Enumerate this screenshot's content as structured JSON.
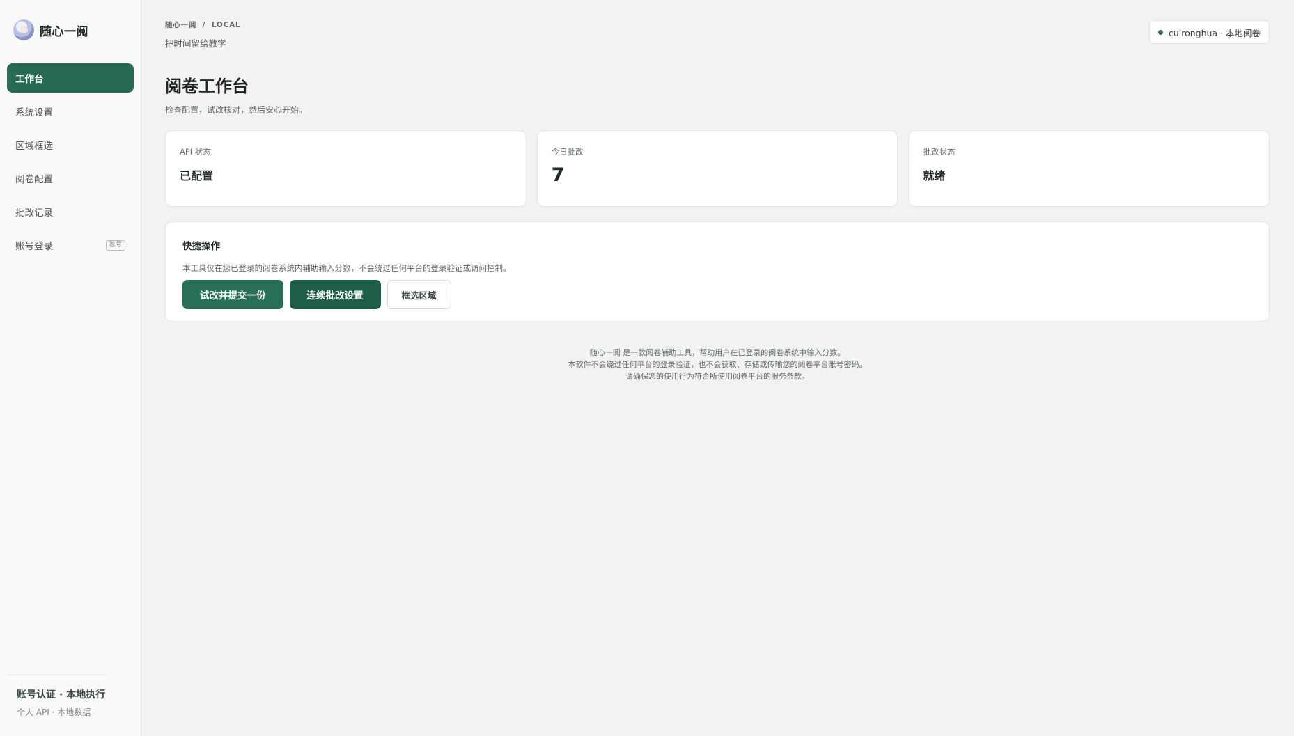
{
  "app": {
    "name": "随心一阅"
  },
  "sidebar": {
    "items": [
      {
        "label": "工作台",
        "active": true
      },
      {
        "label": "系统设置"
      },
      {
        "label": "区域框选"
      },
      {
        "label": "阅卷配置"
      },
      {
        "label": "批改记录"
      },
      {
        "label": "账号登录",
        "badge": "账号"
      }
    ],
    "footer": {
      "title": "账号认证 · 本地执行",
      "subtitle": "个人 API · 本地数据"
    }
  },
  "header": {
    "breadcrumb": [
      "随心一阅",
      "LOCAL"
    ],
    "breadcrumb_sep": "/",
    "slogan": "把时间留给教学",
    "user_chip": "cuironghua · 本地阅卷"
  },
  "page": {
    "title": "阅卷工作台",
    "subtitle": "检查配置，试改核对，然后安心开始。"
  },
  "stats": [
    {
      "label": "API 状态",
      "value": "已配置"
    },
    {
      "label": "今日批改",
      "value": "7"
    },
    {
      "label": "批改状态",
      "value": "就绪"
    }
  ],
  "quick_actions": {
    "title": "快捷操作",
    "description": "本工具仅在您已登录的阅卷系统内辅助输入分数，不会绕过任何平台的登录验证或访问控制。",
    "buttons": [
      "试改并提交一份",
      "连续批改设置",
      "框选区域"
    ]
  },
  "disclaimer": [
    "随心一阅 是一款阅卷辅助工具，帮助用户在已登录的阅卷系统中输入分数。",
    "本软件不会绕过任何平台的登录验证，也不会获取、存储或传输您的阅卷平台账号密码。",
    "请确保您的使用行为符合所使用阅卷平台的服务条款。"
  ],
  "colors": {
    "accent": "#276b53",
    "accent_dark": "#1e5e48",
    "background": "#f2f2f0"
  }
}
